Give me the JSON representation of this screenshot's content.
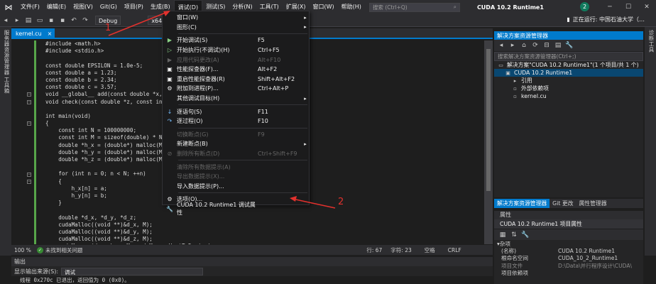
{
  "menubar": {
    "items": [
      "文件(F)",
      "编辑(E)",
      "视图(V)",
      "Git(G)",
      "项目(P)",
      "生成(B)",
      "调试(D)",
      "测试(S)",
      "分析(N)",
      "工具(T)",
      "扩展(X)",
      "窗口(W)",
      "帮助(H)"
    ],
    "search_placeholder": "搜索 (Ctrl+Q)",
    "solution_name": "CUDA 10.2 Runtime1",
    "avatar_letter": "2"
  },
  "toolbar": {
    "config": "Debug",
    "platform": "x64",
    "live_share": "正在运行: 中国石油大学（…"
  },
  "left_rail": {
    "tabs": [
      "服务器资源管理器",
      "工具箱"
    ]
  },
  "editor": {
    "tab_name": "kernel.cu",
    "tab_close": "×",
    "zoom": "100 %",
    "no_issues": "未找到相关问题",
    "line": "行: 67",
    "char": "字符: 23",
    "mode": "空格",
    "eol": "CRLF",
    "code_lines": [
      "#include <math.h>",
      "#include <stdio.h>",
      "",
      "const double EPSILON = 1.0e-5;",
      "const double a = 1.23;",
      "const double b = 2.34;",
      "const double c = 3.57;",
      "void __global__ add(const double *x, c",
      "void check(const double *z, const int",
      "",
      "int main(void)",
      "{",
      "    const int N = 100000000;",
      "    const int M = sizeof(double) * N;",
      "    double *h_x = (double*) malloc(M);",
      "    double *h_y = (double*) malloc(M);",
      "    double *h_z = (double*) malloc(M);",
      "",
      "    for (int n = 0; n < N; ++n)",
      "    {",
      "        h_x[n] = a;",
      "        h_y[n] = b;",
      "    }",
      "",
      "    double *d_x, *d_y, *d_z;",
      "    cudaMalloc((void **)&d_x, M);",
      "    cudaMalloc((void **)&d_y, M);",
      "    cudaMalloc((void **)&d_z, M);",
      "    cudaMemcpy(d_x, h_x, M, cudaMemcpyHostToDevice);"
    ]
  },
  "debug_menu": {
    "items": [
      {
        "icon": "",
        "label": "窗口(W)",
        "shortcut": "",
        "arrow": "▸",
        "disabled": false
      },
      {
        "icon": "",
        "label": "图形(C)",
        "shortcut": "",
        "arrow": "▸",
        "disabled": false
      },
      {
        "sep": true
      },
      {
        "icon": "▶",
        "label": "开始调试(S)",
        "shortcut": "F5",
        "arrow": "",
        "disabled": false
      },
      {
        "icon": "▷",
        "label": "开始执行(不调试)(H)",
        "shortcut": "Ctrl+F5",
        "arrow": "",
        "disabled": false
      },
      {
        "icon": "▶",
        "label": "应用代码更改(A)",
        "shortcut": "Alt+F10",
        "arrow": "",
        "disabled": true
      },
      {
        "icon": "▣",
        "label": "性能探查器(F)...",
        "shortcut": "Alt+F2",
        "arrow": "",
        "disabled": false
      },
      {
        "icon": "▣",
        "label": "重启性能探查器(R)",
        "shortcut": "Shift+Alt+F2",
        "arrow": "",
        "disabled": false
      },
      {
        "icon": "⚙",
        "label": "附加到进程(P)...",
        "shortcut": "Ctrl+Alt+P",
        "arrow": "",
        "disabled": false
      },
      {
        "icon": "",
        "label": "其他调试目标(H)",
        "shortcut": "",
        "arrow": "▸",
        "disabled": false
      },
      {
        "sep": true
      },
      {
        "icon": "↓",
        "label": "逐语句(S)",
        "shortcut": "F11",
        "arrow": "",
        "disabled": false
      },
      {
        "icon": "↷",
        "label": "逐过程(O)",
        "shortcut": "F10",
        "arrow": "",
        "disabled": false
      },
      {
        "sep": true
      },
      {
        "icon": "",
        "label": "切换断点(G)",
        "shortcut": "F9",
        "arrow": "",
        "disabled": true
      },
      {
        "icon": "",
        "label": "新建断点(B)",
        "shortcut": "",
        "arrow": "▸",
        "disabled": false
      },
      {
        "icon": "⊘",
        "label": "删除所有断点(D)",
        "shortcut": "Ctrl+Shift+F9",
        "arrow": "",
        "disabled": true
      },
      {
        "sep": true
      },
      {
        "icon": "",
        "label": "清除所有数据提示(A)",
        "shortcut": "",
        "arrow": "",
        "disabled": true
      },
      {
        "icon": "",
        "label": "导出数据提示(X)...",
        "shortcut": "",
        "arrow": "",
        "disabled": true
      },
      {
        "icon": "",
        "label": "导入数据提示(P)...",
        "shortcut": "",
        "arrow": "",
        "disabled": false
      },
      {
        "sep": true
      },
      {
        "icon": "⚙",
        "label": "选项(O)...",
        "shortcut": "",
        "arrow": "",
        "disabled": false
      },
      {
        "icon": "🔧",
        "label": "CUDA 10.2 Runtime1 调试属性",
        "shortcut": "",
        "arrow": "",
        "disabled": false
      }
    ]
  },
  "annotations": {
    "one": "1",
    "two": "2"
  },
  "solution_explorer": {
    "title": "解决方案资源管理器",
    "search_placeholder": "搜索解决方案资源管理器(Ctrl+;)",
    "tree": [
      {
        "indent": 0,
        "icon": "▭",
        "label": "解决方案\"CUDA 10.2 Runtime1\"(1 个项目/共 1 个)",
        "selected": false
      },
      {
        "indent": 1,
        "icon": "▣",
        "label": "CUDA 10.2 Runtime1",
        "selected": true
      },
      {
        "indent": 2,
        "icon": "▸",
        "label": "引用",
        "selected": false
      },
      {
        "indent": 2,
        "icon": "▫",
        "label": "外部依赖项",
        "selected": false
      },
      {
        "indent": 2,
        "icon": "▫",
        "label": "kernel.cu",
        "selected": false
      }
    ],
    "tabs": [
      "解决方案资源管理器",
      "Git 更改",
      "属性管理器"
    ]
  },
  "properties": {
    "title": "属性",
    "object": "CUDA 10.2 Runtime1  项目属性",
    "category": "杂项",
    "rows": [
      {
        "k": "(名称)",
        "v": "CUDA 10.2 Runtime1",
        "dim": false
      },
      {
        "k": "根命名空间",
        "v": "CUDA_10_2_Runtime1",
        "dim": false
      },
      {
        "k": "项目文件",
        "v": "D:\\Data\\并行程序设计\\CUDA\\",
        "dim": true
      },
      {
        "k": "项目依赖项",
        "v": "",
        "dim": false
      }
    ]
  },
  "right_rail": {
    "tabs": [
      "诊断工具"
    ]
  },
  "output": {
    "title": "输出",
    "source_label": "显示输出来源(S):",
    "source_value": "调试",
    "text": "线程 0x270c 已退出，返回值为 0 (0x0)。"
  }
}
